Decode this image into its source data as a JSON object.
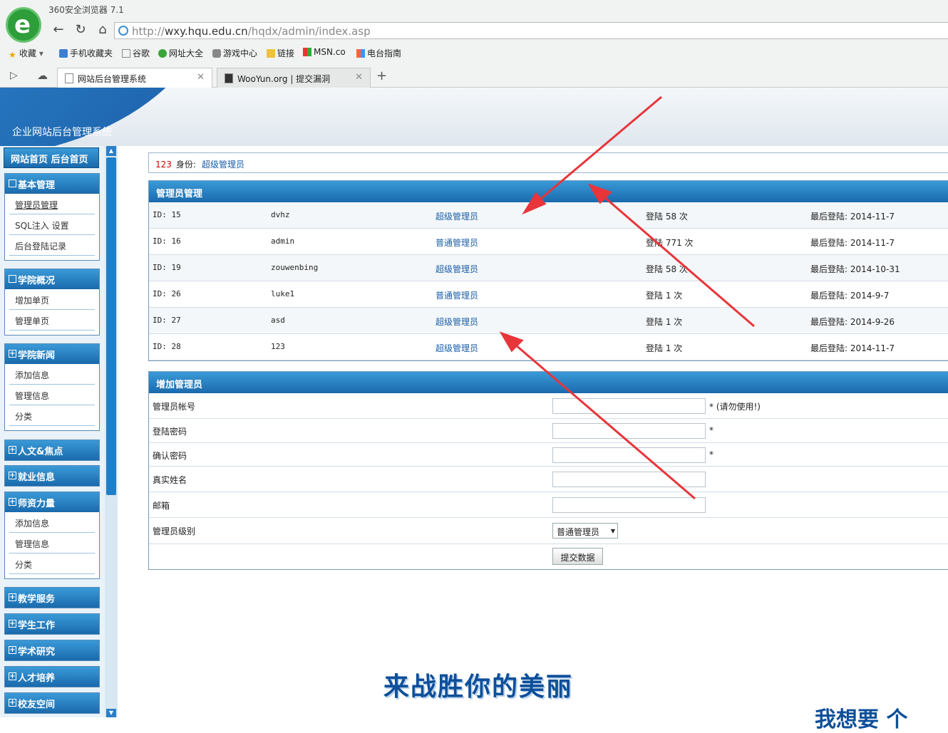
{
  "browser": {
    "title": "360安全浏览器 7.1",
    "logo_letter": "e",
    "url_prefix": "http://",
    "url_host": "wxy.hqu.edu.cn",
    "url_path": "/hqdx/admin/index.asp",
    "bookmarks": [
      "收藏",
      "手机收藏夹",
      "谷歌",
      "网址大全",
      "游戏中心",
      "链接",
      "MSN.co",
      "电台指南"
    ],
    "tabs": [
      {
        "label": "网站后台管理系统",
        "active": true
      },
      {
        "label": "WooYun.org | 提交漏洞",
        "active": false
      }
    ],
    "new_tab": "+"
  },
  "header": {
    "subtitle": "企业网站后台管理系统"
  },
  "sidebar": {
    "top_label": "网站首页 后台首页",
    "groups": [
      {
        "title": "基本管理",
        "marker": "",
        "items": [
          "管理员管理",
          "SQL注入 设置",
          "后台登陆记录"
        ]
      },
      {
        "title": "学院概况",
        "marker": "",
        "items": [
          "增加单页",
          "管理单页"
        ]
      },
      {
        "title": "学院新闻",
        "marker": "+",
        "items": [
          "添加信息",
          "管理信息",
          "分类"
        ]
      },
      {
        "title": "人文&焦点",
        "marker": "+",
        "items": []
      },
      {
        "title": "就业信息",
        "marker": "+",
        "items": []
      },
      {
        "title": "师资力量",
        "marker": "+",
        "items": [
          "添加信息",
          "管理信息",
          "分类"
        ]
      },
      {
        "title": "教学服务",
        "marker": "+",
        "items": []
      },
      {
        "title": "学生工作",
        "marker": "+",
        "items": []
      },
      {
        "title": "学术研究",
        "marker": "+",
        "items": []
      },
      {
        "title": "人才培养",
        "marker": "+",
        "items": []
      },
      {
        "title": "校友空间",
        "marker": "+",
        "items": []
      }
    ]
  },
  "identity": {
    "user": "123",
    "label": "身份:",
    "role": "超级管理员"
  },
  "admin_panel": {
    "title": "管理员管理",
    "rows": [
      {
        "id": "ID: 15",
        "name": "dvhz",
        "role": "超级管理员",
        "logins": "登陆 58 次",
        "last": "最后登陆: 2014-11-7"
      },
      {
        "id": "ID: 16",
        "name": "admin",
        "role": "普通管理员",
        "logins": "登陆 771 次",
        "last": "最后登陆: 2014-11-7"
      },
      {
        "id": "ID: 19",
        "name": "zouwenbing",
        "role": "超级管理员",
        "logins": "登陆 58 次",
        "last": "最后登陆: 2014-10-31"
      },
      {
        "id": "ID: 26",
        "name": "luke1",
        "role": "普通管理员",
        "logins": "登陆 1 次",
        "last": "最后登陆: 2014-9-7"
      },
      {
        "id": "ID: 27",
        "name": "asd",
        "role": "超级管理员",
        "logins": "登陆 1 次",
        "last": "最后登陆: 2014-9-26"
      },
      {
        "id": "ID: 28",
        "name": "123",
        "role": "超级管理员",
        "logins": "登陆 1 次",
        "last": "最后登陆: 2014-11-7"
      }
    ]
  },
  "add_panel": {
    "title": "增加管理员",
    "fields": [
      {
        "label": "管理员帐号",
        "note": "* (请勿使用!)"
      },
      {
        "label": "登陆密码",
        "note": "*"
      },
      {
        "label": "确认密码",
        "note": "*"
      },
      {
        "label": "真实姓名",
        "note": ""
      },
      {
        "label": "邮箱",
        "note": ""
      }
    ],
    "level_label": "管理员级别",
    "level_value": "普通管理员",
    "submit": "提交数据"
  },
  "slogan": "来战胜你的美丽",
  "slogan_partial": "我想要  个",
  "colors": {
    "accent_blue": "#1a6aac",
    "link": "#1a5fa8",
    "annotation_arrow": "#e8353a"
  }
}
